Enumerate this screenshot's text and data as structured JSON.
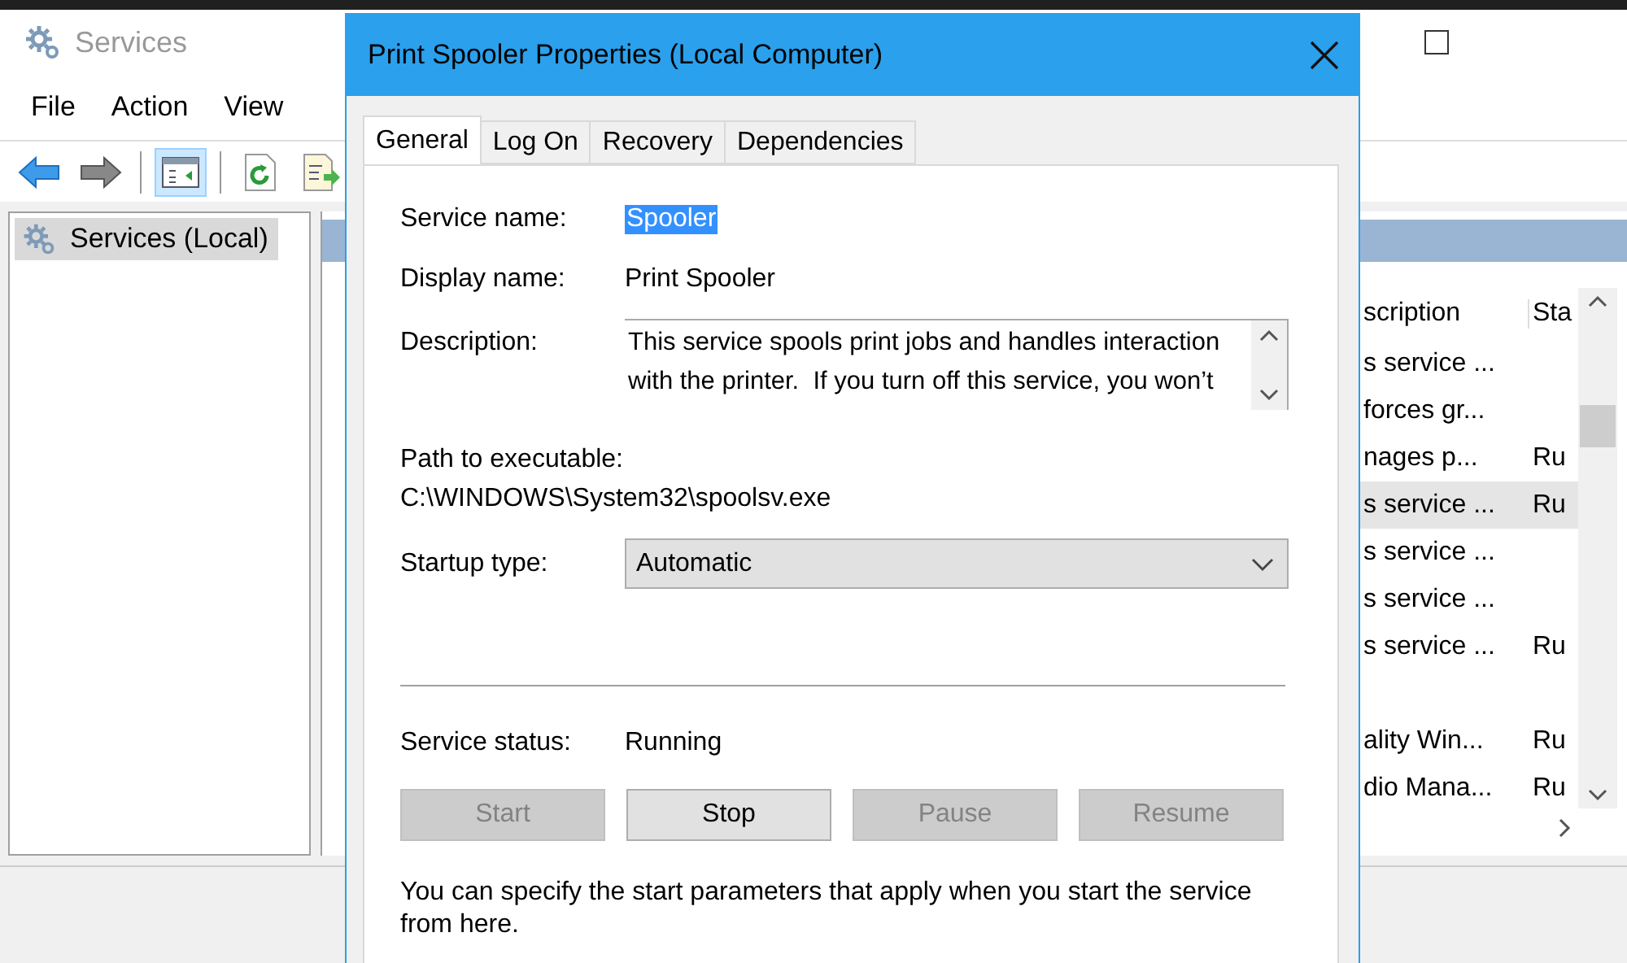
{
  "services_window": {
    "title": "Services",
    "menu": [
      "File",
      "Action",
      "View"
    ],
    "toolbar": [
      {
        "kind": "back",
        "selected": false
      },
      {
        "kind": "forward",
        "selected": false
      },
      {
        "kind": "tree",
        "selected": true
      },
      {
        "kind": "refresh",
        "selected": false
      },
      {
        "kind": "export",
        "selected": false
      }
    ],
    "tree": [
      {
        "label": "Services (Local)",
        "selected": true
      }
    ],
    "list": {
      "columns": [
        "scription",
        "Sta"
      ],
      "rows": [
        {
          "description": "s service ...",
          "selected": false
        },
        {
          "description": "forces gr...",
          "selected": false
        },
        {
          "description": "nages p...",
          "status": "Ru",
          "selected": false
        },
        {
          "description": "s service ...",
          "status": "Ru",
          "selected": true
        },
        {
          "description": "s service ...",
          "selected": false
        },
        {
          "description": "s service ...",
          "selected": false
        },
        {
          "description": "s service ...",
          "status": "Ru",
          "selected": false
        },
        {
          "selected": false
        },
        {
          "description": "ality Win...",
          "status": "Ru",
          "selected": false
        },
        {
          "description": "dio Mana...",
          "status": "Ru",
          "selected": false
        }
      ]
    }
  },
  "dialog": {
    "title": "Print Spooler Properties (Local Computer)",
    "tabs": [
      {
        "label": "General",
        "selected": true
      },
      {
        "label": "Log On",
        "selected": false
      },
      {
        "label": "Recovery",
        "selected": false
      },
      {
        "label": "Dependencies",
        "selected": false
      }
    ],
    "service_name": {
      "label": "Service name:",
      "value": "Spooler",
      "selected": true
    },
    "display_name": {
      "label": "Display name:",
      "value": "Print Spooler"
    },
    "description": {
      "label": "Description:",
      "lines": [
        "This service spools print jobs and handles interaction",
        "with the printer.  If you turn off this service, you won’t"
      ]
    },
    "path": {
      "label": "Path to executable:",
      "value": "C:\\WINDOWS\\System32\\spoolsv.exe"
    },
    "startup_type": {
      "label": "Startup type:",
      "value": "Automatic"
    },
    "service_status": {
      "label": "Service status:",
      "value": "Running"
    },
    "buttons": [
      {
        "label": "Start",
        "disabled": true
      },
      {
        "label": "Stop",
        "disabled": false
      },
      {
        "label": "Pause",
        "disabled": true
      },
      {
        "label": "Resume",
        "disabled": true
      }
    ],
    "note": "You can specify the start parameters that apply when you start the service from here."
  }
}
